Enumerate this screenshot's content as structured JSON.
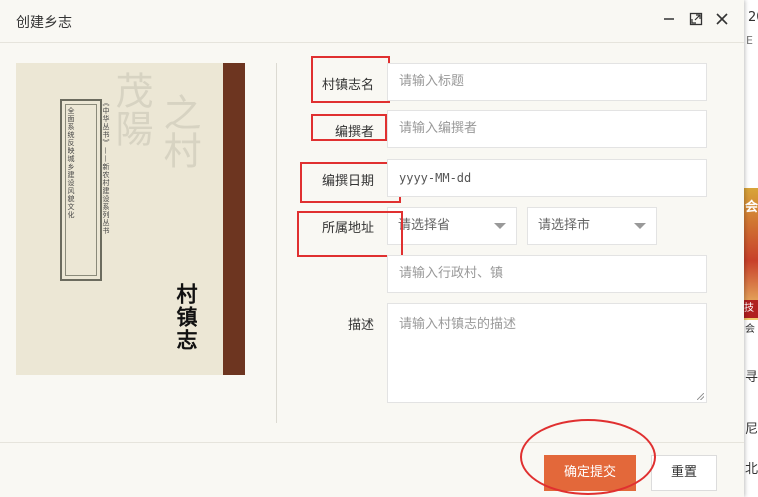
{
  "dialog": {
    "title": "创建乡志",
    "icons": [
      "minimize-icon",
      "maximize-icon",
      "close-icon"
    ]
  },
  "cover": {
    "title": "村镇志",
    "series_text": "《中华丛书》——新农村建设系列丛书",
    "subtitle_text": "全面系统反映城乡建设风貌文化"
  },
  "form": {
    "name_label": "村镇志名",
    "name_placeholder": "请输入标题",
    "editor_label": "编撰者",
    "editor_placeholder": "请输入编撰者",
    "date_label": "编撰日期",
    "date_value": "yyyy-MM-dd",
    "address_label": "所属地址",
    "province_select": "请选择省",
    "city_select": "请选择市",
    "village_placeholder": "请输入行政村、镇",
    "desc_label": "描述",
    "desc_placeholder": "请输入村镇志的描述"
  },
  "footer": {
    "submit_label": "确定提交",
    "reset_label": "重置"
  },
  "background": {
    "fragments": [
      "20",
      "E",
      "会",
      "技",
      "会",
      "寻",
      "尼",
      "北"
    ]
  },
  "colors": {
    "primary_button": "#e3683a",
    "annotation_red": "#e03030",
    "spine": "#6d3520"
  }
}
